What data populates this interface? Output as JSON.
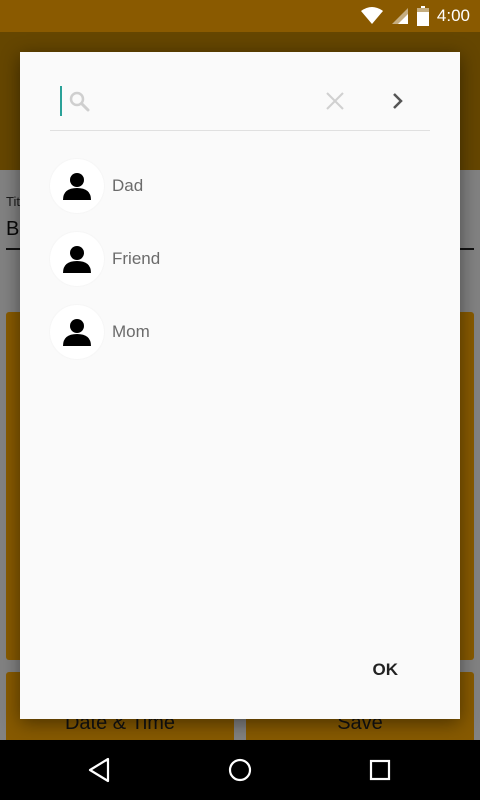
{
  "status_bar": {
    "time": "4:00",
    "icons": [
      "wifi-icon",
      "cell-signal-icon",
      "battery-icon"
    ]
  },
  "background_app": {
    "title_label": "Title",
    "title_value": "Bi",
    "date_button": "Date & Time",
    "save_button": "Save"
  },
  "dialog": {
    "search": {
      "value": "",
      "placeholder": ""
    },
    "contacts": [
      {
        "name": "Dad"
      },
      {
        "name": "Friend"
      },
      {
        "name": "Mom"
      }
    ],
    "ok_label": "OK"
  },
  "nav_bar": {
    "icons": [
      "back-icon",
      "home-icon",
      "recents-icon"
    ]
  },
  "colors": {
    "status_bar": "#8a5a00",
    "accent": "#f6a400",
    "cursor": "#2aa198",
    "dialog_bg": "#fafafa"
  }
}
